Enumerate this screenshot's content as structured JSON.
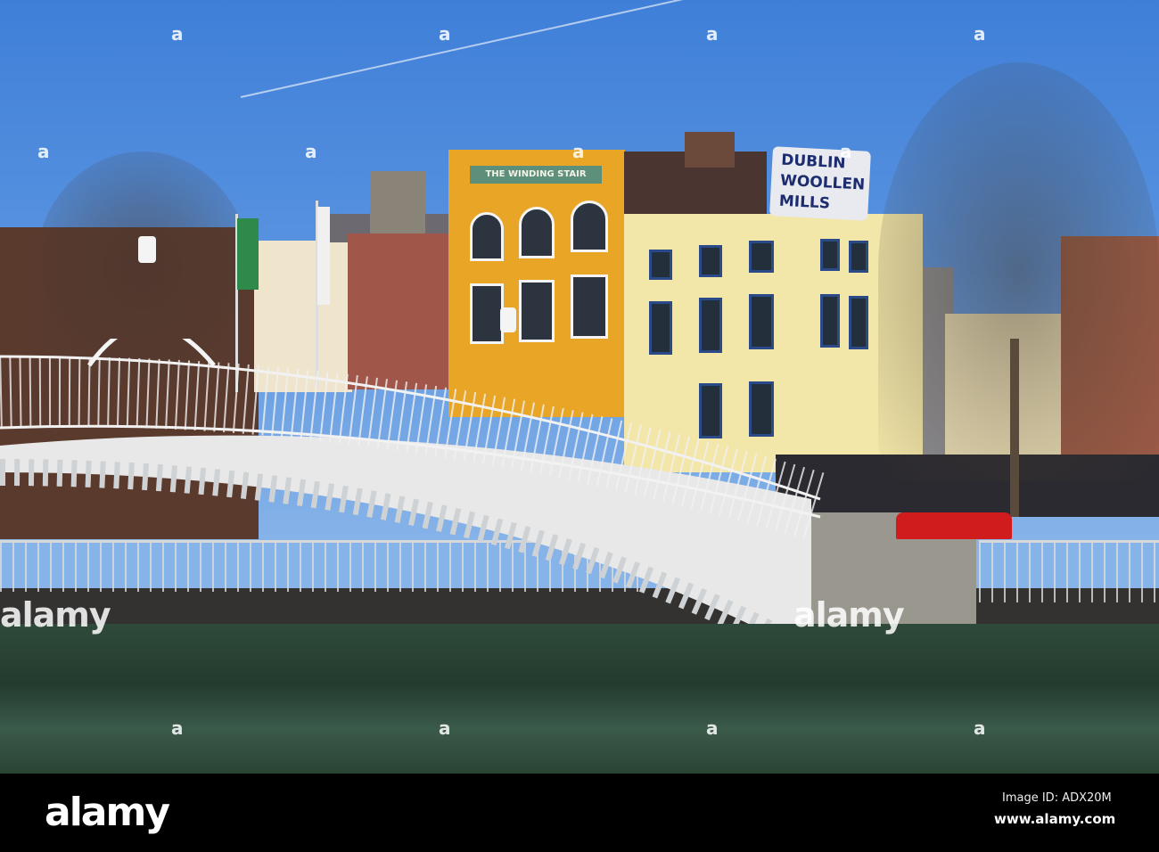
{
  "signs": {
    "winding_stair": "THE WINDING STAIR",
    "woollen_line1": "DUBLIN",
    "woollen_line2": "WOOLLEN",
    "woollen_line3": "MILLS"
  },
  "watermark": {
    "logo": "alamy",
    "mark": "a"
  },
  "footer": {
    "logo": "alamy",
    "image_id": "Image ID: ADX20M",
    "url": "www.alamy.com"
  },
  "colors": {
    "sky": "#4a86dc",
    "yellow_building": "#e8a526",
    "cream_building": "#f2e6a8",
    "river": "#2c4637"
  }
}
